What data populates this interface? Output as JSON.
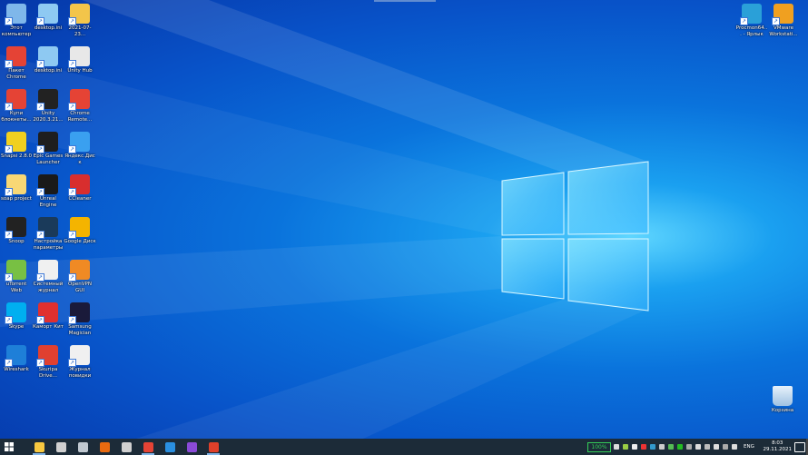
{
  "desktop": {
    "icons": [
      {
        "label": "Этот компьютер",
        "icon": "computer-icon",
        "color": "#7fb7ea"
      },
      {
        "label": "desktop.ini",
        "icon": "ini-file-icon",
        "color": "#8ec9f2"
      },
      {
        "label": "2021-07-23...",
        "icon": "image-file-icon",
        "color": "#f3c54a"
      },
      {
        "label": "Пакет Chrome",
        "icon": "chrome-icon",
        "color": "#e54335"
      },
      {
        "label": "desktop.ini",
        "icon": "ini-file-icon",
        "color": "#8ec9f2"
      },
      {
        "label": "Unity Hub",
        "icon": "unity-hub-icon",
        "color": "#e8e8e8"
      },
      {
        "label": "Купи блокнеты...",
        "icon": "chrome-icon",
        "color": "#e54335"
      },
      {
        "label": "Unity 2020.3.21...",
        "icon": "unity-icon",
        "color": "#222222"
      },
      {
        "label": "Chrome Remote...",
        "icon": "chrome-remote-icon",
        "color": "#e54335"
      },
      {
        "label": "Snapsi 2.8.0",
        "icon": "snap-icon",
        "color": "#f0d020"
      },
      {
        "label": "Epic Games Launcher",
        "icon": "epic-games-icon",
        "color": "#1e1e1e"
      },
      {
        "label": "Яндекс.Диск",
        "icon": "yandex-disk-icon",
        "color": "#3aa0f0"
      },
      {
        "label": "soap project",
        "icon": "folder-icon",
        "color": "#f8d775"
      },
      {
        "label": "Unreal Engine",
        "icon": "unreal-icon",
        "color": "#1a1a1a"
      },
      {
        "label": "CCleaner",
        "icon": "ccleaner-icon",
        "color": "#d82e2e"
      },
      {
        "label": "Snoop",
        "icon": "snoop-icon",
        "color": "#222222"
      },
      {
        "label": "Настройка параметры",
        "icon": "settings-icon",
        "color": "#1a3a5a"
      },
      {
        "label": "Google Диск",
        "icon": "google-drive-icon",
        "color": "#f4b400"
      },
      {
        "label": "uTorrent Web",
        "icon": "utorrent-icon",
        "color": "#78c043"
      },
      {
        "label": "Системный журнал",
        "icon": "document-icon",
        "color": "#f0f0f0"
      },
      {
        "label": "OpenVPN GUI",
        "icon": "openvpn-icon",
        "color": "#f08a24"
      },
      {
        "label": "Skype",
        "icon": "skype-icon",
        "color": "#00aff0"
      },
      {
        "label": "Каморт Кит",
        "icon": "app-red-icon",
        "color": "#e03030"
      },
      {
        "label": "Samsung Magician",
        "icon": "magician-icon",
        "color": "#1a1a3a"
      },
      {
        "label": "Wireshark",
        "icon": "wireshark-icon",
        "color": "#1e7fd8"
      },
      {
        "label": "Skuripa Drive...",
        "icon": "drive-icon",
        "color": "#e04030"
      },
      {
        "label": "Журнал повидки",
        "icon": "document-icon",
        "color": "#f0f0f0"
      }
    ],
    "right_icons": [
      {
        "label": "Procmon64... - Ярлык",
        "icon": "procmon-icon",
        "color": "#2aa0d8"
      },
      {
        "label": "VMware Workstati...",
        "icon": "vmware-icon",
        "color": "#f0a020"
      }
    ],
    "recycle_bin": {
      "label": "Корзина",
      "icon": "recycle-bin-icon"
    }
  },
  "taskbar": {
    "apps": [
      {
        "name": "file-explorer",
        "icon": "folder-icon",
        "color": "#f8c840",
        "active": true
      },
      {
        "name": "app-2",
        "icon": "cloud-icon",
        "color": "#d0d0d0",
        "active": false
      },
      {
        "name": "app-3",
        "icon": "window-icon",
        "color": "#c0c8d0",
        "active": false
      },
      {
        "name": "app-4",
        "icon": "app-icon",
        "color": "#e86a10",
        "active": false
      },
      {
        "name": "app-5",
        "icon": "stack-icon",
        "color": "#d0d0d0",
        "active": false
      },
      {
        "name": "chrome",
        "icon": "chrome-icon",
        "color": "#e54335",
        "active": true
      },
      {
        "name": "vscode",
        "icon": "vscode-icon",
        "color": "#2a8fe0",
        "active": false
      },
      {
        "name": "visual-studio",
        "icon": "visual-studio-icon",
        "color": "#8a4ad8",
        "active": false
      },
      {
        "name": "app-9",
        "icon": "app-icon",
        "color": "#e0402a",
        "active": true
      }
    ],
    "battery": "100%",
    "language": "ENG",
    "time": "8:03",
    "date": "29.11.2021"
  }
}
